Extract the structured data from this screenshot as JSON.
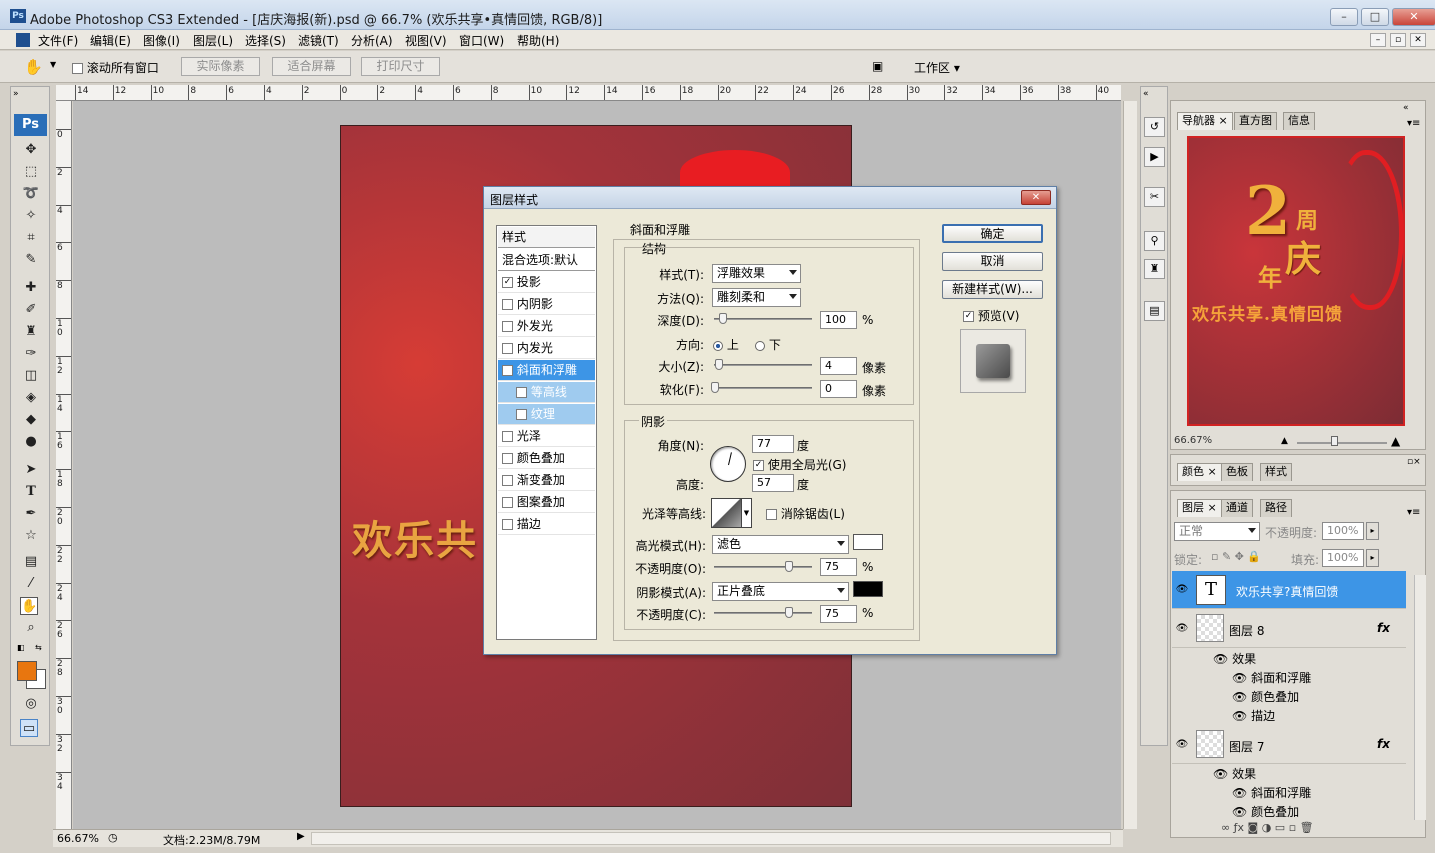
{
  "titlebar": {
    "app_icon": "Ps",
    "title": "Adobe Photoshop CS3 Extended - [店庆海报(新).psd @ 66.7% (欢乐共享•真情回馈, RGB/8)]"
  },
  "menubar": {
    "items": [
      "文件(F)",
      "编辑(E)",
      "图像(I)",
      "图层(L)",
      "选择(S)",
      "滤镜(T)",
      "分析(A)",
      "视图(V)",
      "窗口(W)",
      "帮助(H)"
    ]
  },
  "options": {
    "scroll_all": "滚动所有窗口",
    "actual_pixels": "实际像素",
    "fit_screen": "适合屏幕",
    "print_size": "打印尺寸",
    "workspace": "工作区"
  },
  "toolbox": {
    "logo": "Ps",
    "fg_color": "#e8760f",
    "bg_color": "#ffffff"
  },
  "ruler_top": [
    "14",
    "12",
    "10",
    "8",
    "6",
    "4",
    "2",
    "0",
    "2",
    "4",
    "6",
    "8",
    "10",
    "12",
    "14",
    "16",
    "18",
    "20",
    "22",
    "24",
    "26",
    "28",
    "30",
    "32",
    "34",
    "36",
    "38",
    "40"
  ],
  "ruler_left": [
    "0",
    "2",
    "4",
    "6",
    "8",
    "10",
    "12",
    "14",
    "16",
    "18",
    "20",
    "22",
    "24",
    "26",
    "28",
    "30",
    "32",
    "34"
  ],
  "canvas": {
    "text": "欢乐共"
  },
  "statusbar": {
    "zoom": "66.67%",
    "doc": "文档:2.23M/8.79M"
  },
  "navigator": {
    "tabs": [
      "导航器",
      "直方图",
      "信息"
    ],
    "zoom": "66.67%",
    "thumb_big": "2",
    "thumb_zhou": "周",
    "thumb_qing": "庆",
    "thumb_nian": "年",
    "thumb_text": "欢乐共享.真情回馈"
  },
  "color_panel": {
    "tabs": [
      "颜色",
      "色板",
      "样式"
    ]
  },
  "layers_panel": {
    "tabs": [
      "图层",
      "通道",
      "路径"
    ],
    "blend_mode": "正常",
    "opacity_label": "不透明度:",
    "opacity": "100%",
    "lock_label": "锁定:",
    "fill_label": "填充:",
    "fill": "100%",
    "text_layer": "欢乐共享?真情回馈",
    "layer8": {
      "name": "图层 8",
      "effects_label": "效果",
      "effects": [
        "斜面和浮雕",
        "颜色叠加",
        "描边"
      ]
    },
    "layer7": {
      "name": "图层 7",
      "effects_label": "效果",
      "effects": [
        "斜面和浮雕",
        "颜色叠加"
      ]
    }
  },
  "dialog": {
    "title": "图层样式",
    "styles_header": "样式",
    "blend_default": "混合选项:默认",
    "style_items": [
      {
        "label": "投影",
        "checked": true
      },
      {
        "label": "内阴影",
        "checked": false
      },
      {
        "label": "外发光",
        "checked": false
      },
      {
        "label": "内发光",
        "checked": false
      },
      {
        "label": "斜面和浮雕",
        "checked": true
      },
      {
        "label": "等高线",
        "checked": false
      },
      {
        "label": "纹理",
        "checked": false
      },
      {
        "label": "光泽",
        "checked": false
      },
      {
        "label": "颜色叠加",
        "checked": false
      },
      {
        "label": "渐变叠加",
        "checked": false
      },
      {
        "label": "图案叠加",
        "checked": false
      },
      {
        "label": "描边",
        "checked": false
      }
    ],
    "bevel_title": "斜面和浮雕",
    "structure_title": "结构",
    "style_label": "样式(T):",
    "style_value": "浮雕效果",
    "technique_label": "方法(Q):",
    "technique_value": "雕刻柔和",
    "depth_label": "深度(D):",
    "depth_value": "100",
    "depth_unit": "%",
    "direction_label": "方向:",
    "dir_up": "上",
    "dir_down": "下",
    "size_label": "大小(Z):",
    "size_value": "4",
    "size_unit": "像素",
    "soften_label": "软化(F):",
    "soften_value": "0",
    "soften_unit": "像素",
    "shading_title": "阴影",
    "angle_label": "角度(N):",
    "angle_value": "77",
    "angle_unit": "度",
    "global_light": "使用全局光(G)",
    "altitude_label": "高度:",
    "altitude_value": "57",
    "altitude_unit": "度",
    "gloss_label": "光泽等高线:",
    "antialias": "消除锯齿(L)",
    "highlight_label": "高光模式(H):",
    "highlight_value": "滤色",
    "highlight_color": "#ffffff",
    "hl_opacity_label": "不透明度(O):",
    "hl_opacity_value": "75",
    "hl_unit": "%",
    "shadow_mode_label": "阴影模式(A):",
    "shadow_mode_value": "正片叠底",
    "shadow_color": "#000000",
    "sh_opacity_label": "不透明度(C):",
    "sh_opacity_value": "75",
    "sh_unit": "%",
    "ok": "确定",
    "cancel": "取消",
    "new_style": "新建样式(W)...",
    "preview": "预览(V)"
  }
}
